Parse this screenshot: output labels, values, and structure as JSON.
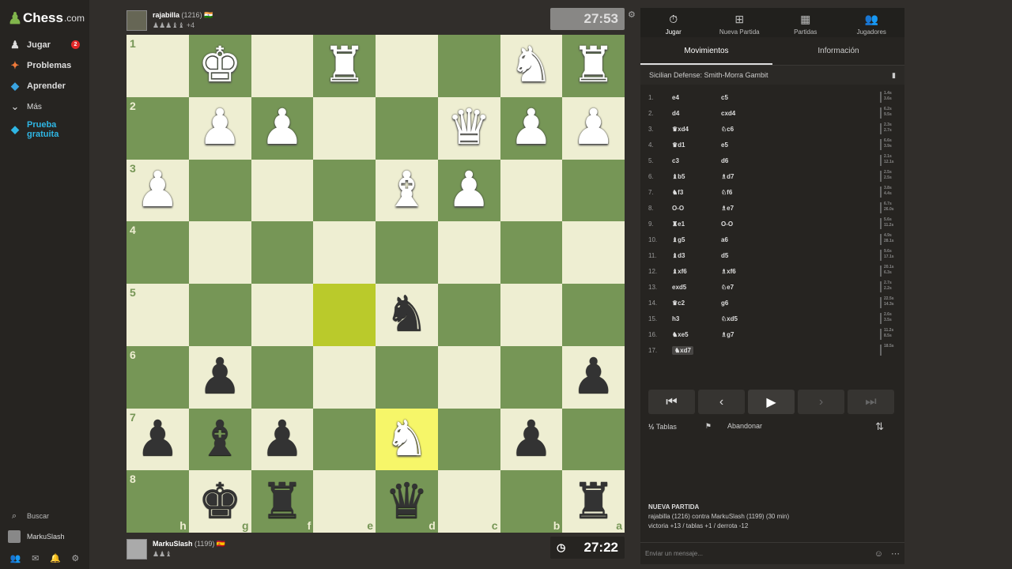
{
  "sidebar": {
    "logo": "Chess",
    "logo_suffix": ".com",
    "items": [
      {
        "label": "Jugar",
        "icon": "♟",
        "badge": "2"
      },
      {
        "label": "Problemas",
        "icon": "✦"
      },
      {
        "label": "Aprender",
        "icon": "◆"
      },
      {
        "label": "Más",
        "icon": "⌄"
      }
    ],
    "trial_label": "Prueba gratuita",
    "search_label": "Buscar",
    "username": "MarkuSlash"
  },
  "top_player": {
    "name": "rajabilla",
    "rating": "(1216)",
    "flag": "🇮🇳",
    "captured": "♟♟♟♝♝ +4",
    "clock": "27:53"
  },
  "bottom_player": {
    "name": "MarkuSlash",
    "rating": "(1199)",
    "flag": "🇪🇸",
    "captured": "♟♟♝",
    "clock": "27:22"
  },
  "board": {
    "ranks": [
      "1",
      "2",
      "3",
      "4",
      "5",
      "6",
      "7",
      "8"
    ],
    "files": [
      "h",
      "g",
      "f",
      "e",
      "d",
      "c",
      "b",
      "a"
    ],
    "rows": [
      [
        "",
        "K",
        "",
        "R",
        "",
        "",
        "N",
        "R"
      ],
      [
        "",
        "P",
        "P",
        "",
        "",
        "Q",
        "P",
        "P"
      ],
      [
        "P",
        "",
        "",
        "",
        "B",
        "P",
        "",
        ""
      ],
      [
        "",
        "",
        "",
        "",
        "",
        "",
        "",
        ""
      ],
      [
        "",
        "",
        "",
        "",
        "n",
        "",
        "",
        ""
      ],
      [
        "",
        "p",
        "",
        "",
        "",
        "",
        "",
        "p"
      ],
      [
        "p",
        "b",
        "p",
        "",
        "N",
        "",
        "p",
        ""
      ],
      [
        "",
        "k",
        "r",
        "",
        "q",
        "",
        "",
        "r"
      ]
    ],
    "highlights": [
      [
        4,
        3
      ],
      [
        6,
        4
      ]
    ]
  },
  "panel": {
    "tabs": [
      {
        "label": "Jugar",
        "icon": "⏱"
      },
      {
        "label": "Nueva Partida",
        "icon": "⊞"
      },
      {
        "label": "Partidas",
        "icon": "▦"
      },
      {
        "label": "Jugadores",
        "icon": "👥"
      }
    ],
    "subtabs": [
      "Movimientos",
      "Información"
    ],
    "opening": "Sicilian Defense: Smith-Morra Gambit",
    "moves": [
      {
        "n": "1.",
        "w": "e4",
        "b": "c5",
        "tw": "1.4s",
        "tb": "3.6s"
      },
      {
        "n": "2.",
        "w": "d4",
        "b": "cxd4",
        "tw": "6.2s",
        "tb": "9.5s"
      },
      {
        "n": "3.",
        "w": "♛xd4",
        "b": "♘c6",
        "tw": "2.3s",
        "tb": "2.7s"
      },
      {
        "n": "4.",
        "w": "♛d1",
        "b": "e5",
        "tw": "6.6s",
        "tb": "3.9s"
      },
      {
        "n": "5.",
        "w": "c3",
        "b": "d6",
        "tw": "2.1s",
        "tb": "12.1s"
      },
      {
        "n": "6.",
        "w": "♝b5",
        "b": "♗d7",
        "tw": "2.5s",
        "tb": "2.5s"
      },
      {
        "n": "7.",
        "w": "♞f3",
        "b": "♘f6",
        "tw": "3.8s",
        "tb": "4.4s"
      },
      {
        "n": "8.",
        "w": "O-O",
        "b": "♗e7",
        "tw": "6.7s",
        "tb": "26.0s"
      },
      {
        "n": "9.",
        "w": "♜e1",
        "b": "O-O",
        "tw": "5.6s",
        "tb": "11.2s"
      },
      {
        "n": "10.",
        "w": "♝g5",
        "b": "a6",
        "tw": "4.9s",
        "tb": "28.1s"
      },
      {
        "n": "11.",
        "w": "♝d3",
        "b": "d5",
        "tw": "9.6s",
        "tb": "17.1s"
      },
      {
        "n": "12.",
        "w": "♝xf6",
        "b": "♗xf6",
        "tw": "20.1s",
        "tb": "6.3s"
      },
      {
        "n": "13.",
        "w": "exd5",
        "b": "♘e7",
        "tw": "2.7s",
        "tb": "2.2s"
      },
      {
        "n": "14.",
        "w": "♛c2",
        "b": "g6",
        "tw": "22.5s",
        "tb": "14.3s"
      },
      {
        "n": "15.",
        "w": "h3",
        "b": "♘xd5",
        "tw": "2.6s",
        "tb": "3.5s"
      },
      {
        "n": "16.",
        "w": "♞xe5",
        "b": "♗g7",
        "tw": "11.2s",
        "tb": "8.5s"
      },
      {
        "n": "17.",
        "w": "♞xd7",
        "b": "",
        "tw": "18.5s",
        "tb": ""
      }
    ],
    "draw_label": "Tablas",
    "resign_label": "Abandonar",
    "new_game_title": "NUEVA PARTIDA",
    "new_game_players": "rajabilla (1216) contra MarkuSlash (1199) (30 min)",
    "new_game_record": "victoria +13 / tablas +1 / derrota -12",
    "message_placeholder": "Enviar un mensaje..."
  }
}
